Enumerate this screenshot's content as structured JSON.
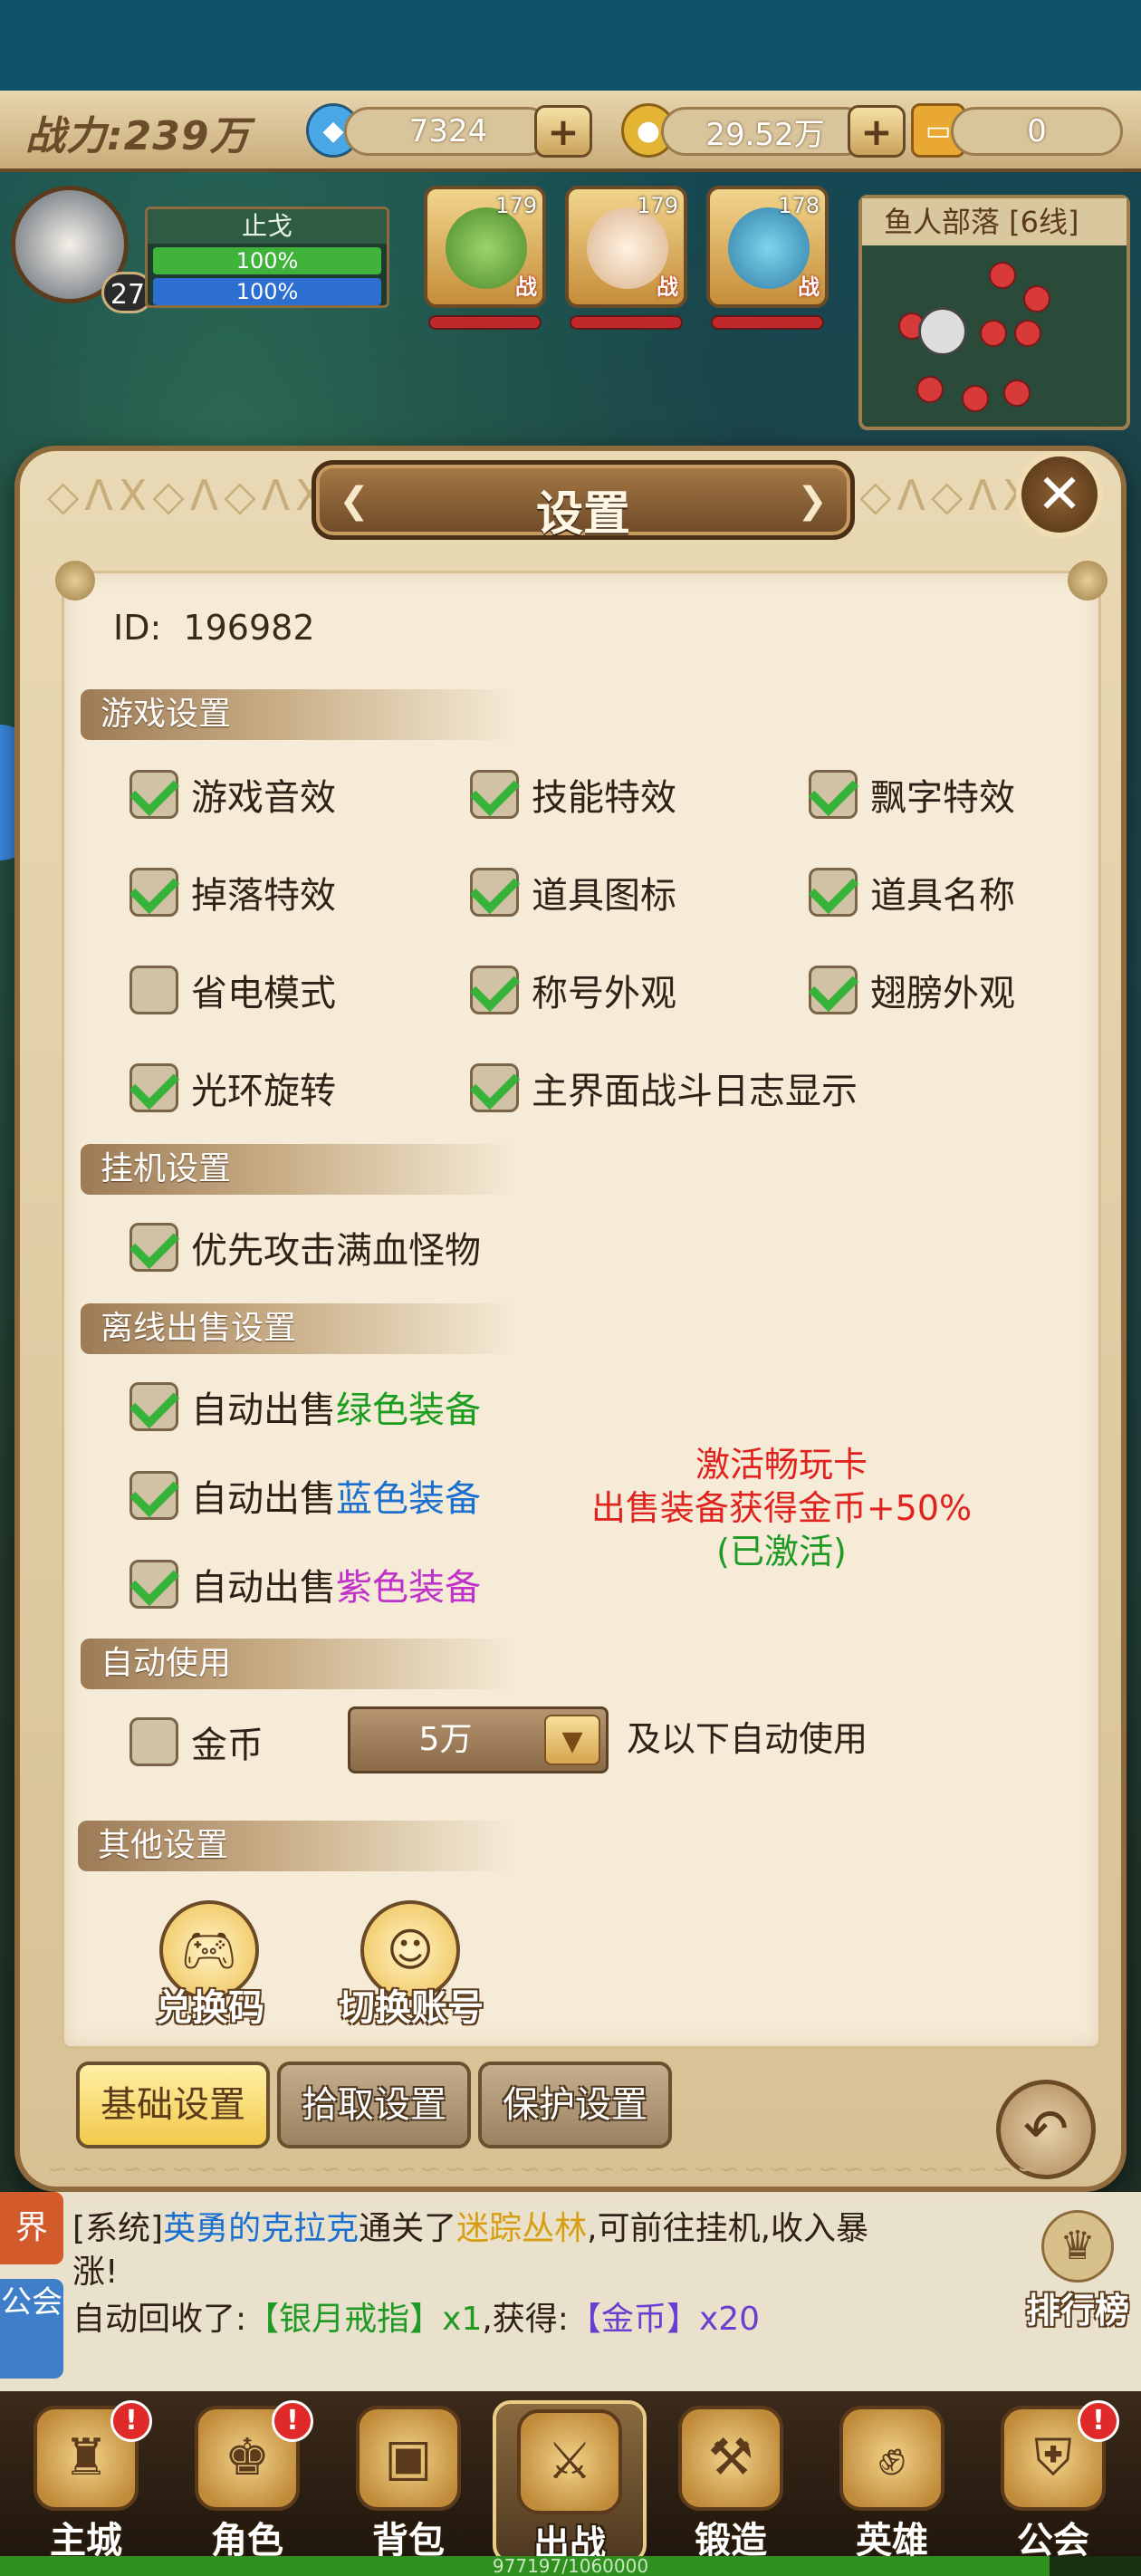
{
  "hud": {
    "power_text": "战力:239万",
    "diamond": "7324",
    "gold": "29.52万",
    "ticket": "0",
    "player_name": "止戈",
    "player_level": "27",
    "hp_text": "100%",
    "mp_text": "100%",
    "heroes": [
      {
        "level": "179",
        "tag": "战"
      },
      {
        "level": "179",
        "tag": "战"
      },
      {
        "level": "178",
        "tag": "战"
      }
    ],
    "map_title": "鱼人部落 [6线]"
  },
  "dialog": {
    "title": "设置",
    "id_label": "ID:",
    "id_value": "196982",
    "sections": {
      "game": "游戏设置",
      "idle": "挂机设置",
      "offline_sell": "离线出售设置",
      "auto_use": "自动使用",
      "other": "其他设置"
    },
    "game_options": [
      {
        "label": "游戏音效",
        "checked": true
      },
      {
        "label": "技能特效",
        "checked": true
      },
      {
        "label": "飘字特效",
        "checked": true
      },
      {
        "label": "掉落特效",
        "checked": true
      },
      {
        "label": "道具图标",
        "checked": true
      },
      {
        "label": "道具名称",
        "checked": true
      },
      {
        "label": "省电模式",
        "checked": false
      },
      {
        "label": "称号外观",
        "checked": true
      },
      {
        "label": "翅膀外观",
        "checked": true
      },
      {
        "label": "光环旋转",
        "checked": true
      },
      {
        "label": "主界面战斗日志显示",
        "checked": true
      }
    ],
    "idle_options": [
      {
        "label": "优先攻击满血怪物",
        "checked": true
      }
    ],
    "sell_prefix": "自动出售",
    "sell_options": [
      {
        "suffix": "绿色装备",
        "checked": true
      },
      {
        "suffix": "蓝色装备",
        "checked": true
      },
      {
        "suffix": "紫色装备",
        "checked": true
      }
    ],
    "promo": {
      "line1": "激活畅玩卡",
      "line2": "出售装备获得金币+50%",
      "line3": "(已激活)"
    },
    "auto_use": {
      "label": "金币",
      "checked": false,
      "selected": "5万",
      "suffix": "及以下自动使用"
    },
    "other_buttons": {
      "redeem": "兑换码",
      "switch": "切换账号"
    },
    "tabs": [
      "基础设置",
      "拾取设置",
      "保护设置"
    ],
    "active_tab": 0
  },
  "chat": {
    "side_top": "界",
    "side_bottom": "公会",
    "line1_prefix": "[系统]",
    "line1_name": "英勇的克拉克",
    "line1_mid": "通关了",
    "line1_place": "迷踪丛林",
    "line1_suffix": ",可前往挂机,收入暴",
    "line2": "涨!",
    "line3_prefix": "自动回收了:",
    "line3_item": "【银月戒指】x1",
    "line3_mid": ",获得:",
    "line3_reward": "【金币】x20",
    "rank_label": "排行榜"
  },
  "nav": {
    "items": [
      "主城",
      "角色",
      "背包",
      "出战",
      "锻造",
      "英雄",
      "公会"
    ],
    "active": 3,
    "exp_text": "977197/1060000",
    "exp_fraction": 0.92
  },
  "colors": {
    "check_green": "#38b33a",
    "promo_red": "#e0231e",
    "promo_green": "#1f9a24"
  }
}
